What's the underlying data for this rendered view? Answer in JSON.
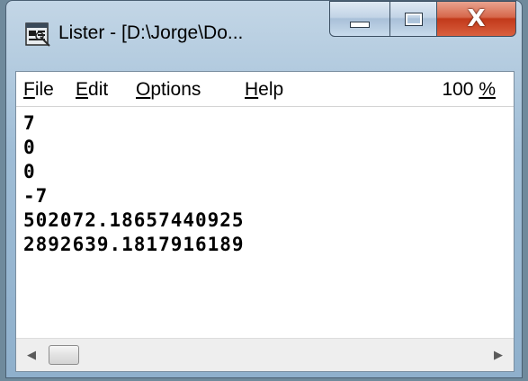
{
  "window": {
    "title": "Lister - [D:\\Jorge\\Do...",
    "icon": "lister-app-icon"
  },
  "caption_buttons": {
    "minimize": "minimize-icon",
    "maximize": "maximize-icon",
    "close_glyph": "X"
  },
  "menu": {
    "file": {
      "accel": "F",
      "rest": "ile"
    },
    "edit": {
      "accel": "E",
      "rest": "dit"
    },
    "options": {
      "accel": "O",
      "rest": "ptions"
    },
    "help": {
      "accel": "H",
      "rest": "elp"
    },
    "zoom": {
      "prefix": "100 ",
      "accel": "%"
    }
  },
  "content": {
    "lines": [
      "7",
      "0",
      "0",
      "-7",
      "502072.18657440925",
      "2892639.1817916189"
    ]
  },
  "scrollbar": {
    "left_arrow": "◀",
    "right_arrow": "▶"
  }
}
